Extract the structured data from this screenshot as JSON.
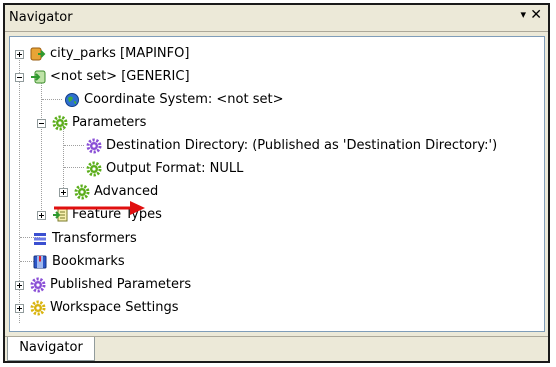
{
  "panel": {
    "title": "Navigator",
    "pin_glyph": "▾",
    "close_glyph": "✕"
  },
  "tree": {
    "city_parks": "city_parks [MAPINFO]",
    "not_set": "<not set> [GENERIC]",
    "coord_system": "Coordinate System: <not set>",
    "parameters": "Parameters",
    "dest_dir": "Destination Directory: (Published as 'Destination Directory:')",
    "output_format": "Output Format: NULL",
    "advanced": "Advanced",
    "feature_types": "Feature Types",
    "transformers": "Transformers",
    "bookmarks": "Bookmarks",
    "published_params": "Published Parameters",
    "workspace_settings": "Workspace Settings"
  },
  "tabs": {
    "navigator": "Navigator"
  },
  "colors": {
    "annotation_arrow": "#e01010",
    "gear_green": "#5cae1c",
    "gear_purple": "#8a4fd6",
    "gear_yellow": "#d9b40f"
  }
}
